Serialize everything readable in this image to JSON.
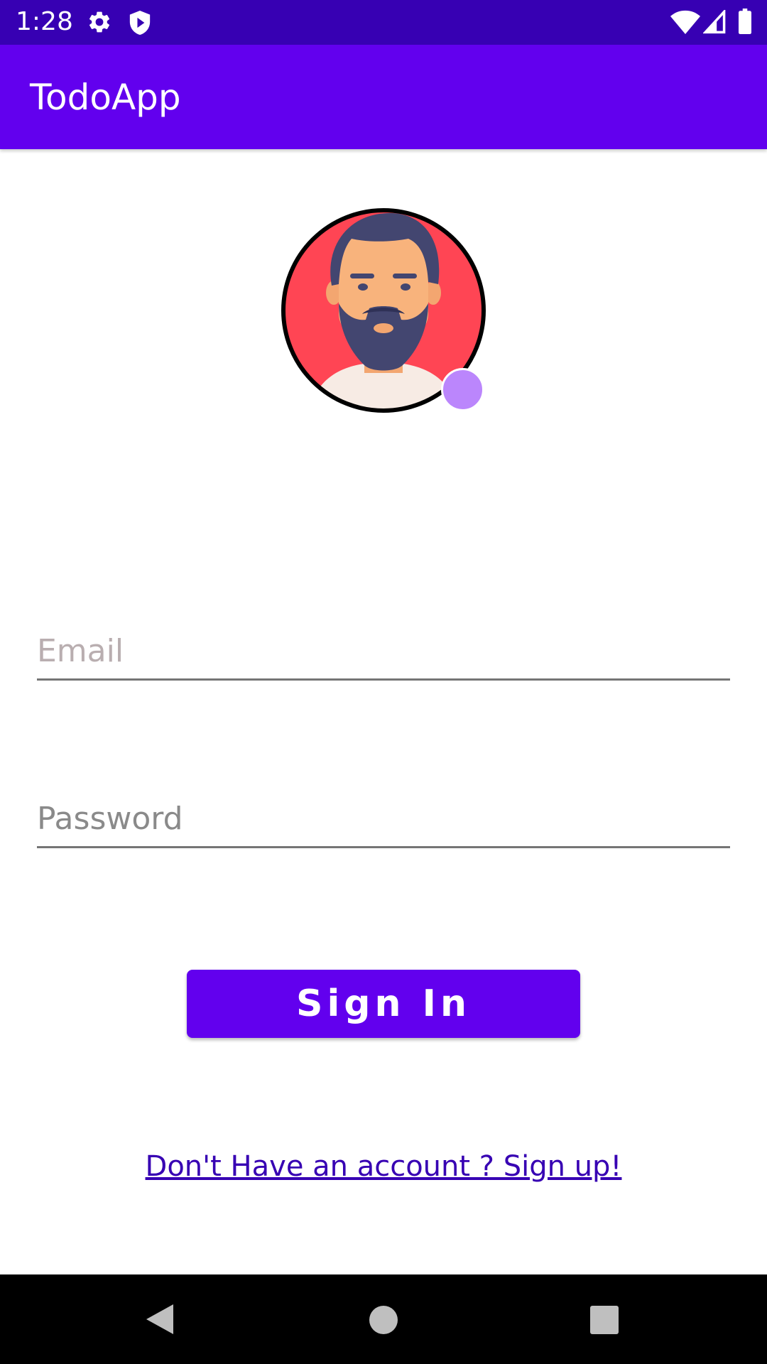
{
  "status_bar": {
    "time": "1:28",
    "icons": [
      "gear-icon",
      "shield-play-icon",
      "wifi-icon",
      "signal-icon",
      "battery-icon"
    ]
  },
  "app_bar": {
    "title": "TodoApp"
  },
  "avatar": {
    "icon": "bearded-man-avatar",
    "edit_badge_color": "#bb86fc"
  },
  "form": {
    "email_placeholder": "Email",
    "email_value": "",
    "password_placeholder": "Password",
    "password_value": ""
  },
  "actions": {
    "signin_label": "Sign In",
    "signup_link": "Don't Have an account ? Sign up!"
  },
  "nav_bar": {
    "icons": [
      "back-icon",
      "home-icon",
      "recents-icon"
    ]
  },
  "colors": {
    "primary": "#6200ee",
    "primary_dark": "#3700b3",
    "accent": "#bb86fc",
    "avatar_background": "#ff4554"
  }
}
